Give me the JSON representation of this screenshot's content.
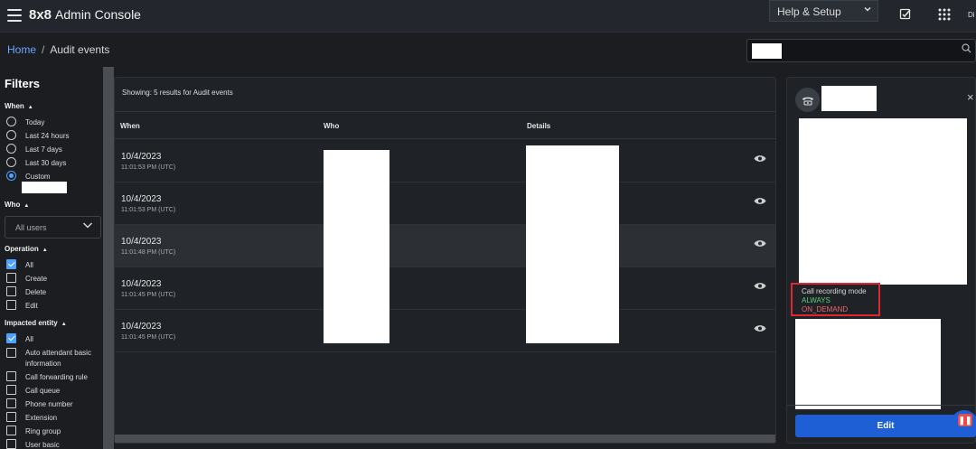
{
  "app": {
    "brand_logo": "8x8",
    "brand_name": "Admin Console",
    "help_label": "Help & Setup",
    "user_initials": "Di"
  },
  "breadcrumb": {
    "home": "Home",
    "separator": "/",
    "current": "Audit events"
  },
  "filters": {
    "title": "Filters",
    "when": {
      "label": "When",
      "options": [
        "Today",
        "Last 24 hours",
        "Last 7 days",
        "Last 30 days",
        "Custom"
      ],
      "selected": "Custom"
    },
    "who": {
      "label": "Who",
      "selected": "All users"
    },
    "operation": {
      "label": "Operation",
      "options": [
        "All",
        "Create",
        "Delete",
        "Edit"
      ],
      "checked": [
        "All"
      ]
    },
    "impacted_entity": {
      "label": "Impacted entity",
      "options": [
        "All",
        "Auto attendant basic information",
        "Call forwarding rule",
        "Call queue",
        "Phone number",
        "Extension",
        "Ring group",
        "User basic"
      ],
      "checked": [
        "All"
      ]
    }
  },
  "results": {
    "showing_text": "Showing: 5 results for Audit events",
    "columns": [
      "When",
      "Who",
      "Details"
    ],
    "rows": [
      {
        "date": "10/4/2023",
        "time": "11:01:53 PM (UTC)"
      },
      {
        "date": "10/4/2023",
        "time": "11:01:53 PM (UTC)"
      },
      {
        "date": "10/4/2023",
        "time": "11:01:48 PM (UTC)"
      },
      {
        "date": "10/4/2023",
        "time": "11:01:45 PM (UTC)"
      },
      {
        "date": "10/4/2023",
        "time": "11:01:45 PM (UTC)"
      }
    ]
  },
  "detail": {
    "recording_label": "Call recording mode",
    "old_value": "ALWAYS",
    "new_value": "ON_DEMAND",
    "edit_label": "Edit",
    "close_glyph": "×"
  },
  "colors": {
    "accent": "#4da3ff",
    "primary_button": "#1f5fd6",
    "highlight_border": "#e0262f",
    "added_value": "#59d07a",
    "removed_value": "#f0656a"
  },
  "icons": [
    "menu-icon",
    "tasks-icon",
    "apps-grid-icon",
    "search-icon",
    "eye-icon",
    "phone-icon",
    "close-icon",
    "chat-icon",
    "chevron-down-icon"
  ]
}
